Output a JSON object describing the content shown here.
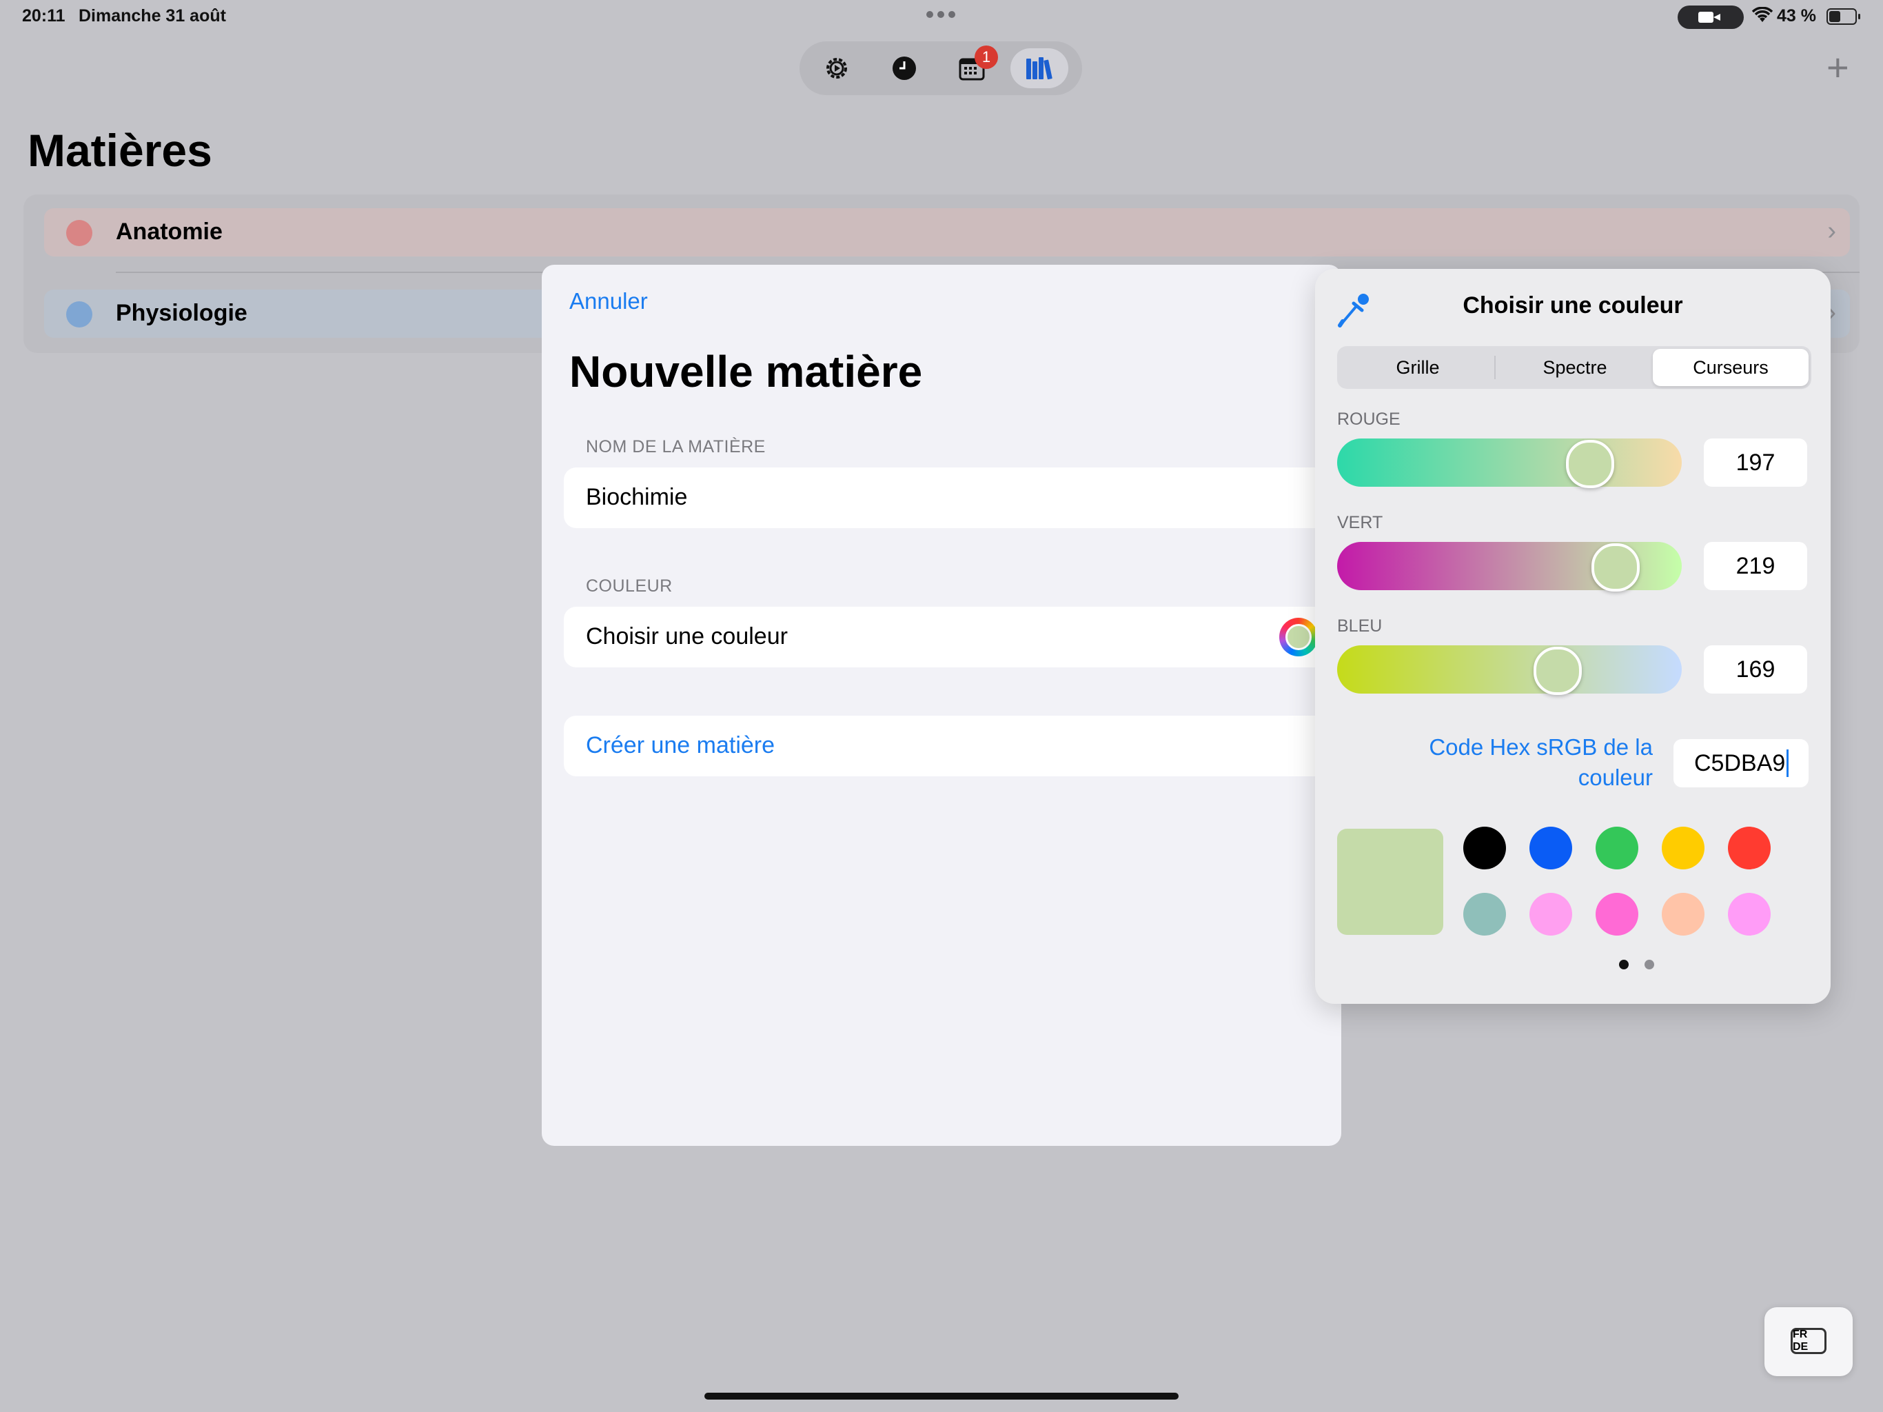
{
  "status_bar": {
    "time": "20:11",
    "date": "Dimanche 31 août",
    "battery": "43 %"
  },
  "tabbar": {
    "tabs": [
      {
        "name": "settings",
        "icon": "gear-icon"
      },
      {
        "name": "clock",
        "icon": "clock-icon"
      },
      {
        "name": "calendar",
        "icon": "calendar-icon",
        "badge": "1"
      },
      {
        "name": "library",
        "icon": "books-icon",
        "active": true
      }
    ]
  },
  "page": {
    "title": "Matières"
  },
  "subjects": [
    {
      "label": "Anatomie",
      "color": "#e57a7a"
    },
    {
      "label": "Physiologie",
      "color": "#7aa7d9"
    }
  ],
  "sheet": {
    "cancel": "Annuler",
    "title": "Nouvelle matière",
    "name_section": "NOM DE LA MATIÈRE",
    "name_value": "Biochimie",
    "color_section": "COULEUR",
    "color_row": "Choisir une couleur",
    "create": "Créer une matière"
  },
  "picker": {
    "title": "Choisir une couleur",
    "segments": [
      "Grille",
      "Spectre",
      "Curseurs"
    ],
    "selected_segment": "Curseurs",
    "sliders": [
      {
        "label": "ROUGE",
        "value": "197",
        "fraction": 0.773
      },
      {
        "label": "VERT",
        "value": "219",
        "fraction": 0.859
      },
      {
        "label": "BLEU",
        "value": "169",
        "fraction": 0.663
      }
    ],
    "hex_label": "Code Hex sRGB de la couleur",
    "hex_value": "C5DBA9",
    "current_color": "#c5dba9",
    "swatches": [
      "#000000",
      "#0a5cf5",
      "#34c759",
      "#ffcc00",
      "#ff3b30",
      "#8fbfba",
      "#ff9ff0",
      "#ff6ad5",
      "#ffc4a8",
      "#ff9cf7"
    ],
    "page_count": 2,
    "current_page": 1
  },
  "keyboard_switch": {
    "label": "FR DE"
  }
}
